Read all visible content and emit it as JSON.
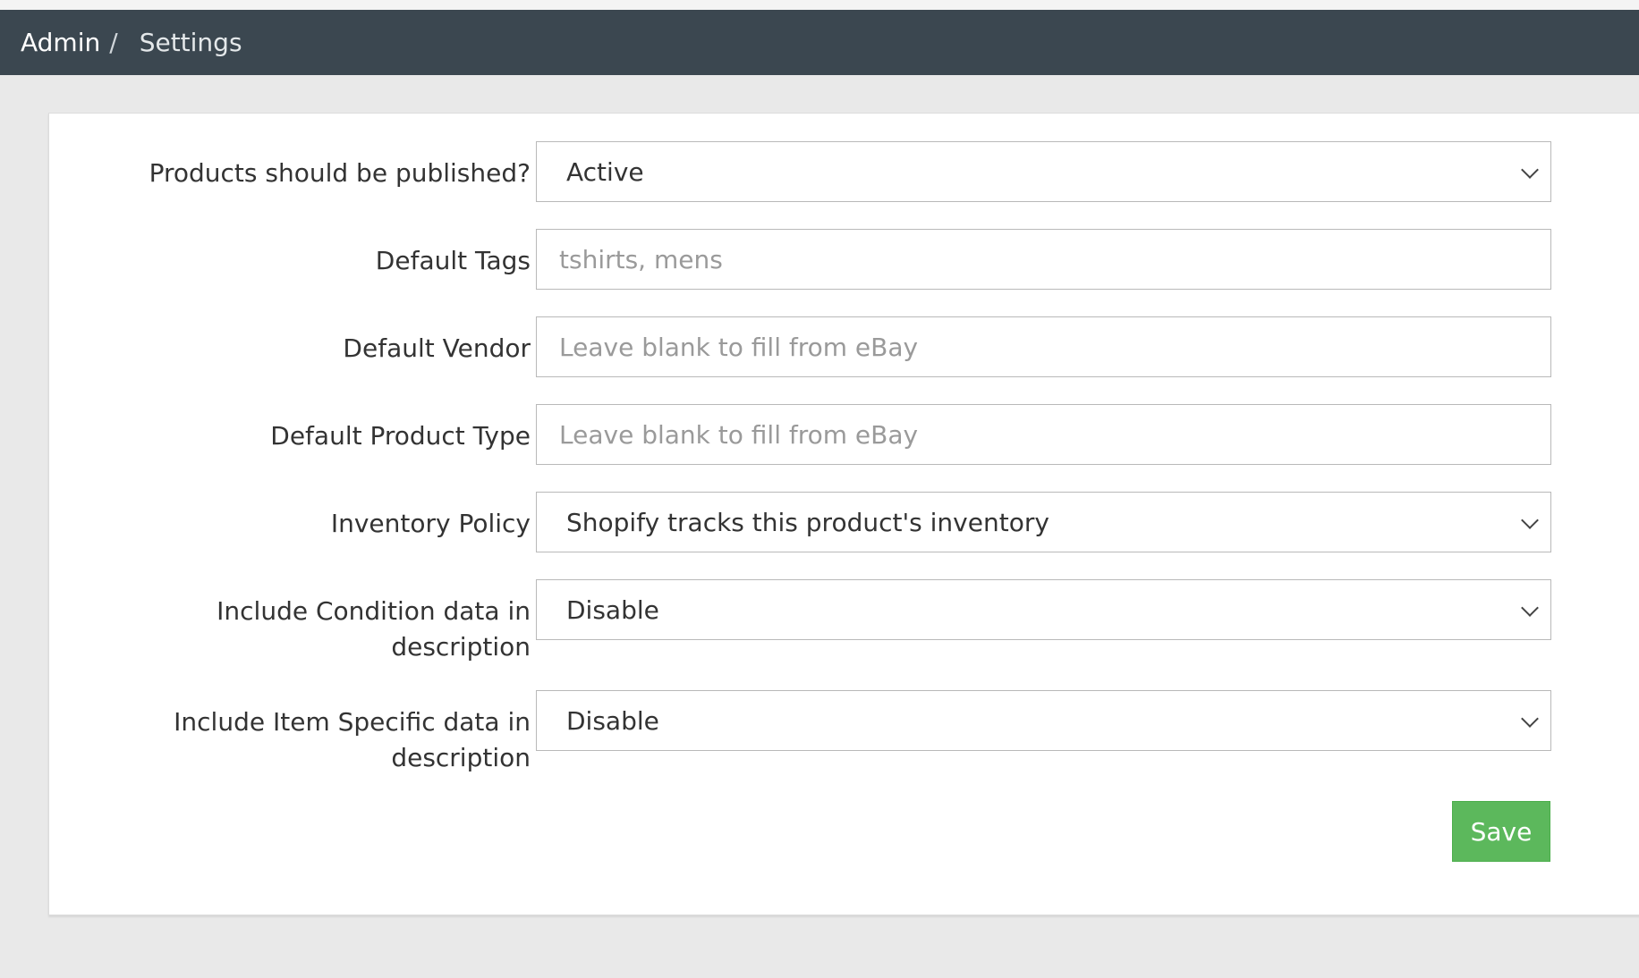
{
  "breadcrumb": {
    "admin": "Admin",
    "separator": "/",
    "current": "Settings"
  },
  "form": {
    "published": {
      "label": "Products should be published?",
      "value": "Active"
    },
    "tags": {
      "label": "Default Tags",
      "placeholder": "tshirts, mens"
    },
    "vendor": {
      "label": "Default Vendor",
      "placeholder": "Leave blank to fill from eBay"
    },
    "product_type": {
      "label": "Default Product Type",
      "placeholder": "Leave blank to fill from eBay"
    },
    "inventory_policy": {
      "label": "Inventory Policy",
      "value": "Shopify tracks this product's inventory"
    },
    "condition": {
      "label_line1": "Include Condition data in",
      "label_line2": "description",
      "value": "Disable"
    },
    "item_specific": {
      "label_line1": "Include Item Specific data in",
      "label_line2": "description",
      "value": "Disable"
    }
  },
  "actions": {
    "save_label": "Save"
  },
  "colors": {
    "header_bg": "#3b4750",
    "page_bg": "#e9e9e9",
    "save_green": "#5cb85c"
  }
}
